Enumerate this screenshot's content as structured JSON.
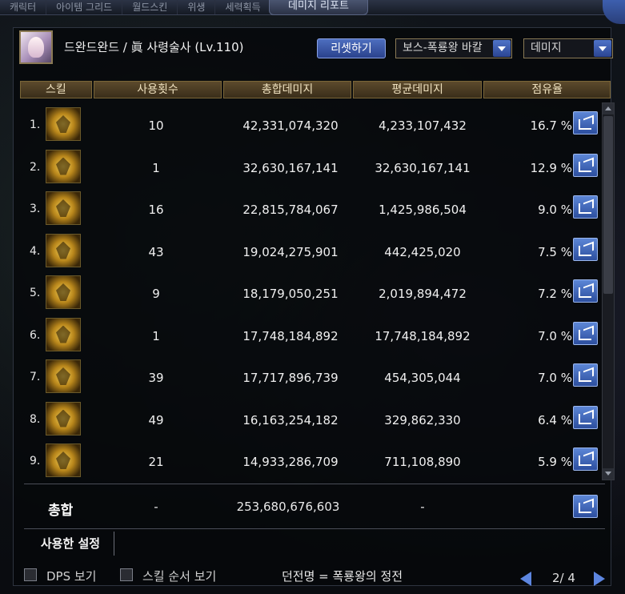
{
  "window": {
    "title": "데미지 리포트",
    "background_tabs": [
      "캐릭터",
      "아이템 그리드",
      "월드스킨",
      "위생",
      "세력획득"
    ]
  },
  "header": {
    "character_name": "드완드완드 / 眞 사령술사 (Lv.110)",
    "reset_button": "리셋하기",
    "dungeon_select": "보스-폭룡왕 바칼",
    "metric_select": "데미지"
  },
  "table": {
    "columns": [
      "스킬",
      "사용횟수",
      "총합데미지",
      "평균데미지",
      "점유율"
    ],
    "rows": [
      {
        "index": "1.",
        "skill_icon": "burst-claw-skill-icon",
        "count": "10",
        "total": "42,331,074,320",
        "avg": "4,233,107,432",
        "share": "16.7 %"
      },
      {
        "index": "2.",
        "skill_icon": "mask-face-skill-icon",
        "count": "1",
        "total": "32,630,167,141",
        "avg": "32,630,167,141",
        "share": "12.9 %"
      },
      {
        "index": "3.",
        "skill_icon": "shatter-burst-skill-icon",
        "count": "16",
        "total": "22,815,784,067",
        "avg": "1,425,986,504",
        "share": "9.0 %"
      },
      {
        "index": "4.",
        "skill_icon": "dark-hand-skill-icon",
        "count": "43",
        "total": "19,024,275,901",
        "avg": "442,425,020",
        "share": "7.5 %"
      },
      {
        "index": "5.",
        "skill_icon": "spirit-flame-skill-icon",
        "count": "9",
        "total": "18,179,050,251",
        "avg": "2,019,894,472",
        "share": "7.2 %"
      },
      {
        "index": "6.",
        "skill_icon": "summon-figure-skill-icon",
        "count": "1",
        "total": "17,748,184,892",
        "avg": "17,748,184,892",
        "share": "7.0 %"
      },
      {
        "index": "7.",
        "skill_icon": "serpent-skill-icon",
        "count": "39",
        "total": "17,717,896,739",
        "avg": "454,305,044",
        "share": "7.0 %"
      },
      {
        "index": "8.",
        "skill_icon": "slash-wave-skill-icon",
        "count": "49",
        "total": "16,163,254,182",
        "avg": "329,862,330",
        "share": "6.4 %"
      },
      {
        "index": "9.",
        "skill_icon": "crack-web-skill-icon",
        "count": "21",
        "total": "14,933,286,709",
        "avg": "711,108,890",
        "share": "5.9 %"
      }
    ]
  },
  "total": {
    "label": "총합",
    "count": "-",
    "total": "253,680,676,603",
    "avg": "-"
  },
  "settings_tab": "사용한 설정",
  "footer": {
    "dps_checkbox": "DPS 보기",
    "skill_order_checkbox": "스킬 순서 보기",
    "dungeon_name": "던전명 = 폭룡왕의 정전",
    "page": "2/ 4"
  },
  "colors": {
    "accent_blue": "#2d4f9f",
    "gold_header": "#5c4a2c",
    "panel_bg": "#06080a"
  }
}
